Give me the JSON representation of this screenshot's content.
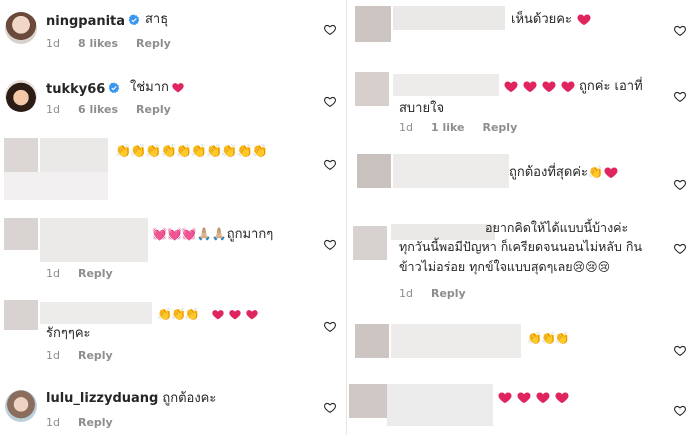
{
  "left": [
    {
      "user": "ningpanita",
      "verified": true,
      "text": "สาธุ",
      "time": "1d",
      "likes": "8 likes",
      "reply": "Reply"
    },
    {
      "user": "tukky66",
      "verified": true,
      "text": "ใช่มาก",
      "time": "1d",
      "likes": "6 likes",
      "reply": "Reply"
    },
    {
      "emojis": "👏👏👏👏👏👏👏👏👏👏"
    },
    {
      "text": "ถูกมากๆ",
      "emojis": "💓💓💓🙏🏼🙏🏼",
      "time": "1d",
      "reply": "Reply"
    },
    {
      "text": "รักๆๆคะ",
      "emojis": "👏👏👏",
      "time": "1d",
      "reply": "Reply"
    },
    {
      "user": "lulu_lizzyduang",
      "text": "ถูกต้องคะ",
      "time": "1d",
      "reply": "Reply"
    }
  ],
  "right": [
    {
      "text": "เห็นด้วยคะ"
    },
    {
      "text_line1": "ถูกค่ะ เอาที่",
      "text_line2": "สบายใจ",
      "time": "1d",
      "likes": "1 like",
      "reply": "Reply"
    },
    {
      "text": "ถูกต้องที่สุดค่ะ",
      "emojis": "👏"
    },
    {
      "line1": "อยากคิดให้ได้แบบนี้บ้างค่ะ",
      "line2": "ทุกวันนี้พอมีปัญหา ก็เครียดจนนอนไม่หลับ กิน",
      "line3": "ข้าวไม่อร่อย ทุกข์ใจแบบสุดๆเลย",
      "emojis": "😢😢😢",
      "time": "1d",
      "reply": "Reply"
    },
    {
      "emojis": "👏👏👏"
    },
    {}
  ],
  "colors": {
    "text": "#262626",
    "meta": "#8e8e8e",
    "heart_red": "#e0245e",
    "verified": "#3897f0"
  }
}
